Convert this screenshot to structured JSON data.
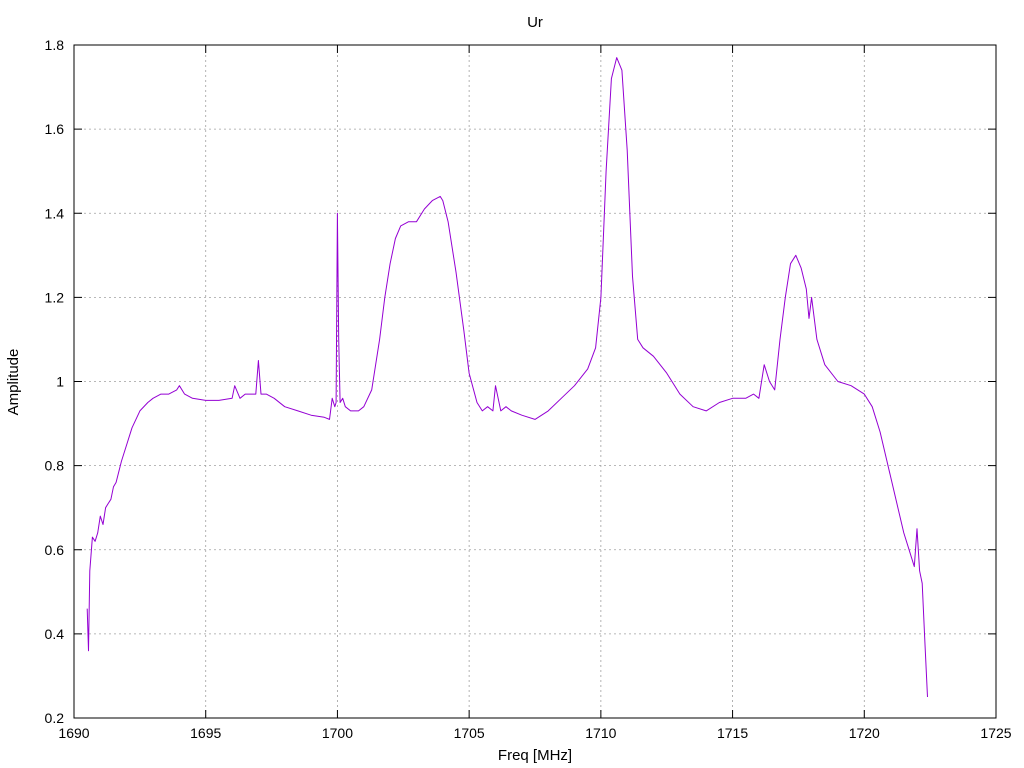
{
  "chart_data": {
    "type": "line",
    "title": "Ur",
    "xlabel": "Freq [MHz]",
    "ylabel": "Amplitude",
    "xlim": [
      1690,
      1725
    ],
    "ylim": [
      0.2,
      1.8
    ],
    "xticks": [
      1690,
      1695,
      1700,
      1705,
      1710,
      1715,
      1720,
      1725
    ],
    "yticks": [
      0.2,
      0.4,
      0.6,
      0.8,
      1,
      1.2,
      1.4,
      1.6,
      1.8
    ],
    "grid": true,
    "series": [
      {
        "color": "#9400d3",
        "x": [
          1690.5,
          1690.55,
          1690.6,
          1690.7,
          1690.8,
          1690.9,
          1691.0,
          1691.1,
          1691.2,
          1691.3,
          1691.4,
          1691.5,
          1691.6,
          1691.8,
          1692.0,
          1692.2,
          1692.5,
          1692.8,
          1693.0,
          1693.3,
          1693.6,
          1693.9,
          1694.0,
          1694.2,
          1694.5,
          1695.0,
          1695.5,
          1696.0,
          1696.1,
          1696.3,
          1696.5,
          1696.9,
          1697.0,
          1697.1,
          1697.3,
          1697.6,
          1698.0,
          1698.5,
          1699.0,
          1699.5,
          1699.7,
          1699.8,
          1699.9,
          1699.95,
          1700.0,
          1700.05,
          1700.1,
          1700.2,
          1700.3,
          1700.5,
          1700.8,
          1701.0,
          1701.3,
          1701.6,
          1701.8,
          1702.0,
          1702.2,
          1702.4,
          1702.7,
          1703.0,
          1703.3,
          1703.6,
          1703.9,
          1704.0,
          1704.2,
          1704.5,
          1704.8,
          1705.0,
          1705.3,
          1705.5,
          1705.7,
          1705.9,
          1706.0,
          1706.2,
          1706.4,
          1706.6,
          1707.0,
          1707.5,
          1708.0,
          1708.5,
          1709.0,
          1709.5,
          1709.8,
          1710.0,
          1710.2,
          1710.4,
          1710.6,
          1710.8,
          1711.0,
          1711.2,
          1711.4,
          1711.6,
          1712.0,
          1712.5,
          1713.0,
          1713.5,
          1714.0,
          1714.5,
          1715.0,
          1715.5,
          1715.8,
          1716.0,
          1716.2,
          1716.4,
          1716.6,
          1716.8,
          1717.0,
          1717.2,
          1717.4,
          1717.6,
          1717.8,
          1717.9,
          1718.0,
          1718.2,
          1718.5,
          1719.0,
          1719.5,
          1720.0,
          1720.3,
          1720.6,
          1720.9,
          1721.2,
          1721.5,
          1721.7,
          1721.9,
          1722.0,
          1722.1,
          1722.2,
          1722.3,
          1722.4
        ],
        "y": [
          0.46,
          0.36,
          0.55,
          0.63,
          0.62,
          0.64,
          0.68,
          0.66,
          0.7,
          0.71,
          0.72,
          0.75,
          0.76,
          0.81,
          0.85,
          0.89,
          0.93,
          0.95,
          0.96,
          0.97,
          0.97,
          0.98,
          0.99,
          0.97,
          0.96,
          0.955,
          0.955,
          0.96,
          0.99,
          0.96,
          0.97,
          0.97,
          1.05,
          0.97,
          0.97,
          0.96,
          0.94,
          0.93,
          0.92,
          0.915,
          0.91,
          0.96,
          0.94,
          0.95,
          1.4,
          1.1,
          0.95,
          0.96,
          0.94,
          0.93,
          0.93,
          0.94,
          0.98,
          1.1,
          1.2,
          1.28,
          1.34,
          1.37,
          1.38,
          1.38,
          1.41,
          1.43,
          1.44,
          1.43,
          1.38,
          1.26,
          1.12,
          1.02,
          0.95,
          0.93,
          0.94,
          0.93,
          0.99,
          0.93,
          0.94,
          0.93,
          0.92,
          0.91,
          0.93,
          0.96,
          0.99,
          1.03,
          1.08,
          1.2,
          1.5,
          1.72,
          1.77,
          1.74,
          1.55,
          1.25,
          1.1,
          1.08,
          1.06,
          1.02,
          0.97,
          0.94,
          0.93,
          0.95,
          0.96,
          0.96,
          0.97,
          0.96,
          1.04,
          1.0,
          0.98,
          1.1,
          1.2,
          1.28,
          1.3,
          1.27,
          1.22,
          1.15,
          1.2,
          1.1,
          1.04,
          1.0,
          0.99,
          0.97,
          0.94,
          0.88,
          0.8,
          0.72,
          0.64,
          0.6,
          0.56,
          0.65,
          0.55,
          0.52,
          0.38,
          0.25
        ]
      }
    ]
  }
}
